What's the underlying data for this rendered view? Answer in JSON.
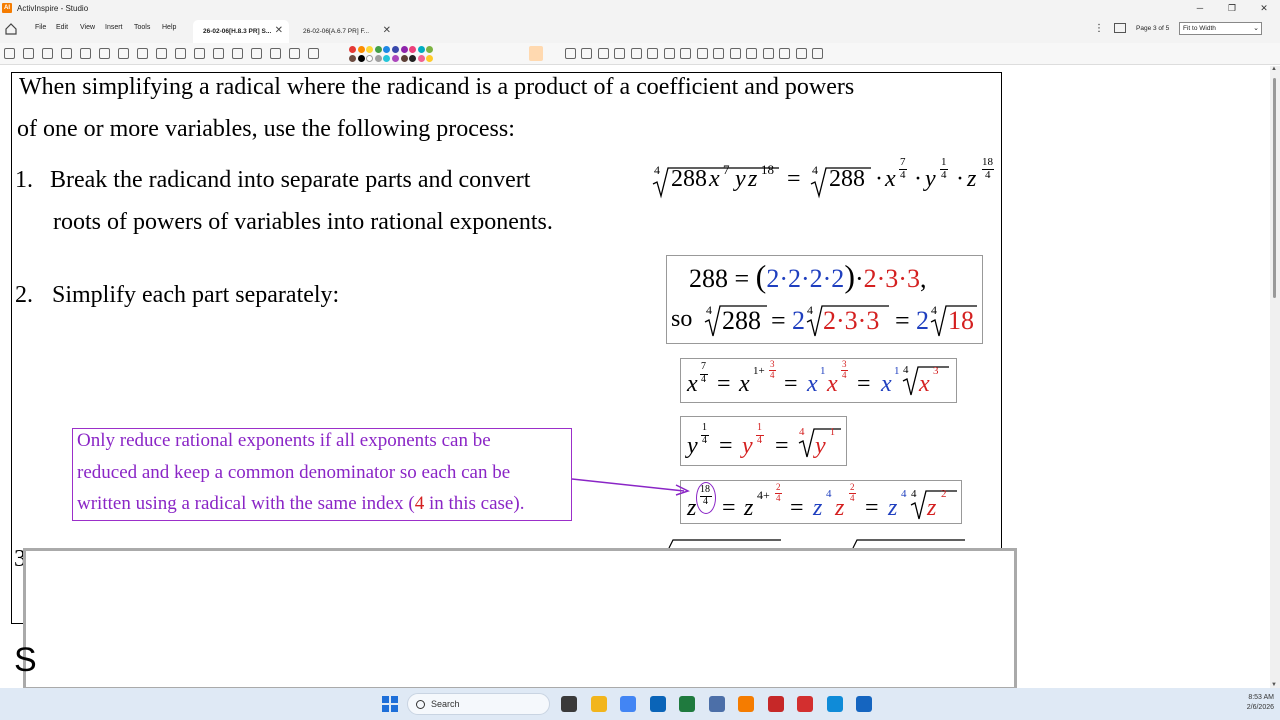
{
  "window": {
    "app_icon_text": "AI",
    "title": "ActivInspire - Studio",
    "min_label": "─",
    "max_label": "❐",
    "close_label": "✕"
  },
  "menu": {
    "items": [
      "File",
      "Edit",
      "View",
      "Insert",
      "Tools",
      "Help"
    ],
    "more_label": "⋮"
  },
  "tabs": [
    {
      "label": "26-02-06[H.8.3 PR] S...",
      "active": true
    },
    {
      "label": "26-02-06[A.6.7 PR] F...",
      "active": false
    }
  ],
  "tab_close": "✕",
  "page_indicator": "Page 3 of 5",
  "zoom": {
    "value": "Fit to Width",
    "chevron": "⌄"
  },
  "colors": {
    "palette": [
      "#e53935",
      "#fb8c00",
      "#fdd835",
      "#43a047",
      "#1e88e5",
      "#3949ab",
      "#8e24aa",
      "#ec407a",
      "#00acc1",
      "#7cb342",
      "#6d4c41",
      "#000000",
      "#ffffff",
      "#9e9e9e",
      "#26c6da",
      "#ab47bc",
      "#5d4037",
      "#212121",
      "#f06292",
      "#ffca28"
    ],
    "accent_purple": "#8a25c6",
    "math_blue": "#1f3fbf",
    "math_red": "#d42020"
  },
  "toolbar_icons": [
    "new-page-icon",
    "open-icon",
    "save-icon",
    "text-icon",
    "image-icon",
    "web-icon",
    "camera-icon",
    "copy-icon",
    "link-icon",
    "grid-icon",
    "tools-icon",
    "spotlight-icon",
    "text-tool-icon",
    "fill-icon",
    "shape-icon",
    "pen-icon",
    "marker-icon",
    "pointer-icon",
    "eraser-icon",
    "delete-icon",
    "undo-icon",
    "redo-icon",
    "page-prev-icon",
    "page-next-icon",
    "reveal-icon",
    "clock-icon",
    "globe-icon",
    "group-icon",
    "align-icon",
    "lock-icon",
    "star-icon",
    "layer-icon",
    "dual-user-icon",
    "more-tools-icon"
  ],
  "slide": {
    "intro_line1": "When simplifying a radical where the radicand is a product of a coefficient and powers",
    "intro_line2": "of one or more variables, use the following process:",
    "step1_num": "1.",
    "step1_line1": "Break the radicand into separate parts and convert",
    "step1_line2": "roots of powers of variables into rational exponents.",
    "step2_num": "2.",
    "step2_line1": "Simplify each part separately:",
    "step3_num": "3",
    "note_line1": "Only reduce rational exponents if all exponents can be",
    "note_line2": "reduced and keep a common denominator so each can be",
    "note_line3_pre": "written using a radical with the same index (",
    "note_line3_num": "4",
    "note_line3_post": " in this case)."
  },
  "math": {
    "root_index": "4",
    "step1_lhs_radicand": "288",
    "var_x": "x",
    "var_y": "y",
    "var_z": "z",
    "exp_7": "7",
    "exp_18": "18",
    "exp_1": "1",
    "exp_2": "2",
    "exp_3": "3",
    "den_4": "4",
    "num_288": "288",
    "factors_blue": "2·2·2·2",
    "factors_red": "2·3·3",
    "so": "so",
    "coef_2": "2",
    "num_18": "18",
    "exp_4": "4",
    "exp_4plus": "4+",
    "exp_1plus": "1+",
    "equals": "=",
    "cdot": "·",
    "comma": ","
  },
  "taskbar": {
    "search_placeholder": "Search",
    "time": "8:53 AM",
    "date": "2/6/2026",
    "apps": [
      "file-explorer-icon",
      "chrome-icon",
      "outlook-icon",
      "excel-icon",
      "remote-icon",
      "activinspire-icon",
      "reader-icon",
      "v-app-icon",
      "edge-icon",
      "notepad-icon",
      "plugin-icon"
    ]
  }
}
